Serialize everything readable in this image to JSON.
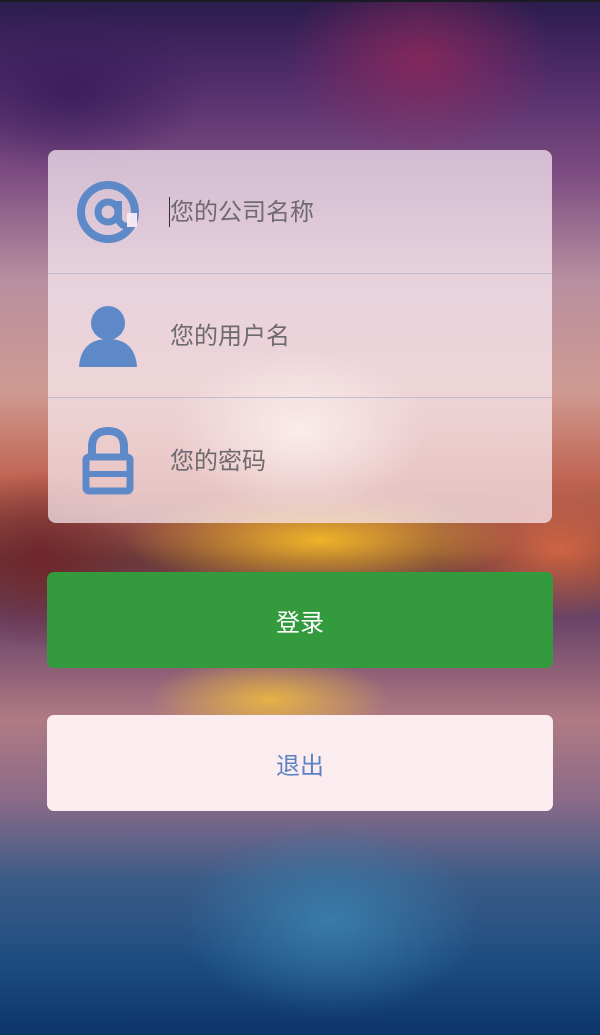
{
  "form": {
    "company_placeholder": "您的公司名称",
    "username_placeholder": "您的用户名",
    "password_placeholder": "您的密码"
  },
  "buttons": {
    "login_label": "登录",
    "exit_label": "退出"
  },
  "icons": {
    "company": "at-sign-icon",
    "username": "user-icon",
    "password": "lock-icon"
  },
  "colors": {
    "icon_blue": "#5d89c8",
    "login_green": "#339a3e",
    "exit_text_blue": "#5b83c4"
  }
}
